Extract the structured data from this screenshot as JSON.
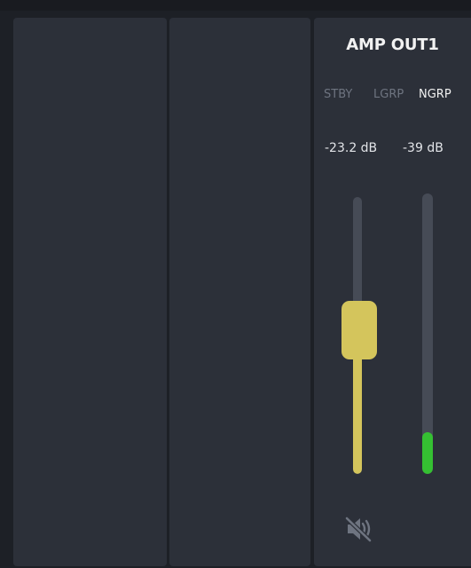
{
  "channel": {
    "title": "AMP OUT1",
    "modes": [
      {
        "label": "STBY",
        "active": false
      },
      {
        "label": "LGRP",
        "active": false
      },
      {
        "label": "NGRP",
        "active": true
      }
    ],
    "gain_readout": "-23.2 dB",
    "level_readout": "-39 dB",
    "fader_position": 0.52,
    "meter_level": 0.15,
    "muted": true,
    "mute_icon": "speaker-muted-icon"
  },
  "colors": {
    "fader_accent": "#d4c55c",
    "meter_green": "#35c032",
    "track": "#464b56",
    "panel": "#2c3039",
    "background": "#1d2026",
    "inactive_text": "#6e7480",
    "active_text": "#f2f2f2"
  }
}
